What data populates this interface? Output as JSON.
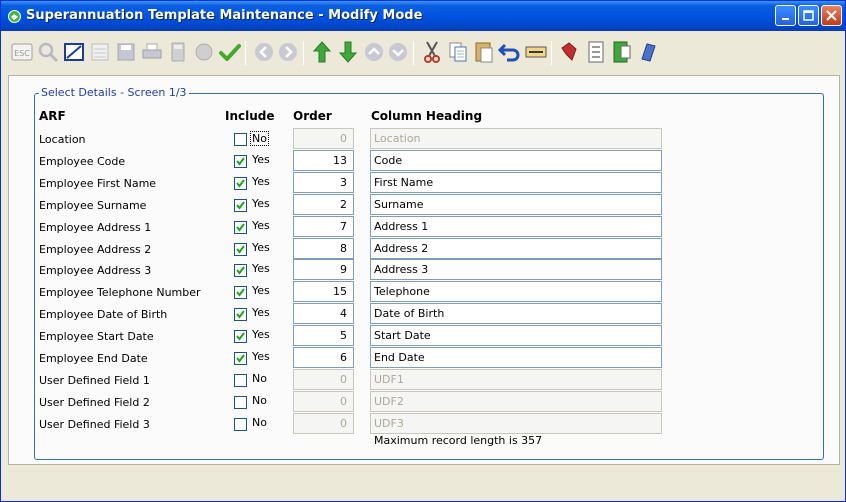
{
  "window": {
    "title": "Superannuation Template Maintenance - Modify Mode"
  },
  "toolbar": {
    "esc_label": "ESC",
    "icons": [
      "esc-icon",
      "search-icon",
      "pen-icon",
      "list-icon",
      "save-icon",
      "print-icon",
      "calculator-icon",
      "globe-icon",
      "check-icon",
      "arrow-left-circle-icon",
      "arrow-right-circle-icon",
      "arrow-up-green-icon",
      "arrow-down-green-icon",
      "arrow-up-circle-icon",
      "arrow-down-circle-icon",
      "cut-icon",
      "copy-icon",
      "paste-icon",
      "undo-icon",
      "keyboard-icon",
      "bird-icon",
      "sort-az-icon",
      "export-icon",
      "help-icon"
    ]
  },
  "group": {
    "legend": "Select Details - Screen 1/3"
  },
  "columns": {
    "field": "ARF",
    "include": "Include",
    "order": "Order",
    "heading": "Column Heading"
  },
  "rows": [
    {
      "label": "Location",
      "include": "No",
      "checked": false,
      "order": "0",
      "heading": "Location",
      "enabled": false
    },
    {
      "label": "Employee Code",
      "include": "Yes",
      "checked": true,
      "order": "13",
      "heading": "Code",
      "enabled": true
    },
    {
      "label": "Employee First Name",
      "include": "Yes",
      "checked": true,
      "order": "3",
      "heading": "First Name",
      "enabled": true
    },
    {
      "label": "Employee Surname",
      "include": "Yes",
      "checked": true,
      "order": "2",
      "heading": "Surname",
      "enabled": true
    },
    {
      "label": "Employee Address 1",
      "include": "Yes",
      "checked": true,
      "order": "7",
      "heading": "Address 1",
      "enabled": true
    },
    {
      "label": "Employee Address 2",
      "include": "Yes",
      "checked": true,
      "order": "8",
      "heading": "Address 2",
      "enabled": true
    },
    {
      "label": "Employee Address 3",
      "include": "Yes",
      "checked": true,
      "order": "9",
      "heading": "Address 3",
      "enabled": true
    },
    {
      "label": "Employee Telephone Number",
      "include": "Yes",
      "checked": true,
      "order": "15",
      "heading": "Telephone",
      "enabled": true
    },
    {
      "label": "Employee Date of Birth",
      "include": "Yes",
      "checked": true,
      "order": "4",
      "heading": "Date of Birth",
      "enabled": true
    },
    {
      "label": "Employee Start Date",
      "include": "Yes",
      "checked": true,
      "order": "5",
      "heading": "Start Date",
      "enabled": true
    },
    {
      "label": "Employee End Date",
      "include": "Yes",
      "checked": true,
      "order": "6",
      "heading": "End Date",
      "enabled": true
    },
    {
      "label": "User Defined Field 1",
      "include": "No",
      "checked": false,
      "order": "0",
      "heading": "UDF1",
      "enabled": false
    },
    {
      "label": "User Defined Field 2",
      "include": "No",
      "checked": false,
      "order": "0",
      "heading": "UDF2",
      "enabled": false
    },
    {
      "label": "User Defined Field 3",
      "include": "No",
      "checked": false,
      "order": "0",
      "heading": "UDF3",
      "enabled": false
    }
  ],
  "footer": {
    "max_record_length": "Maximum record length is  357"
  }
}
